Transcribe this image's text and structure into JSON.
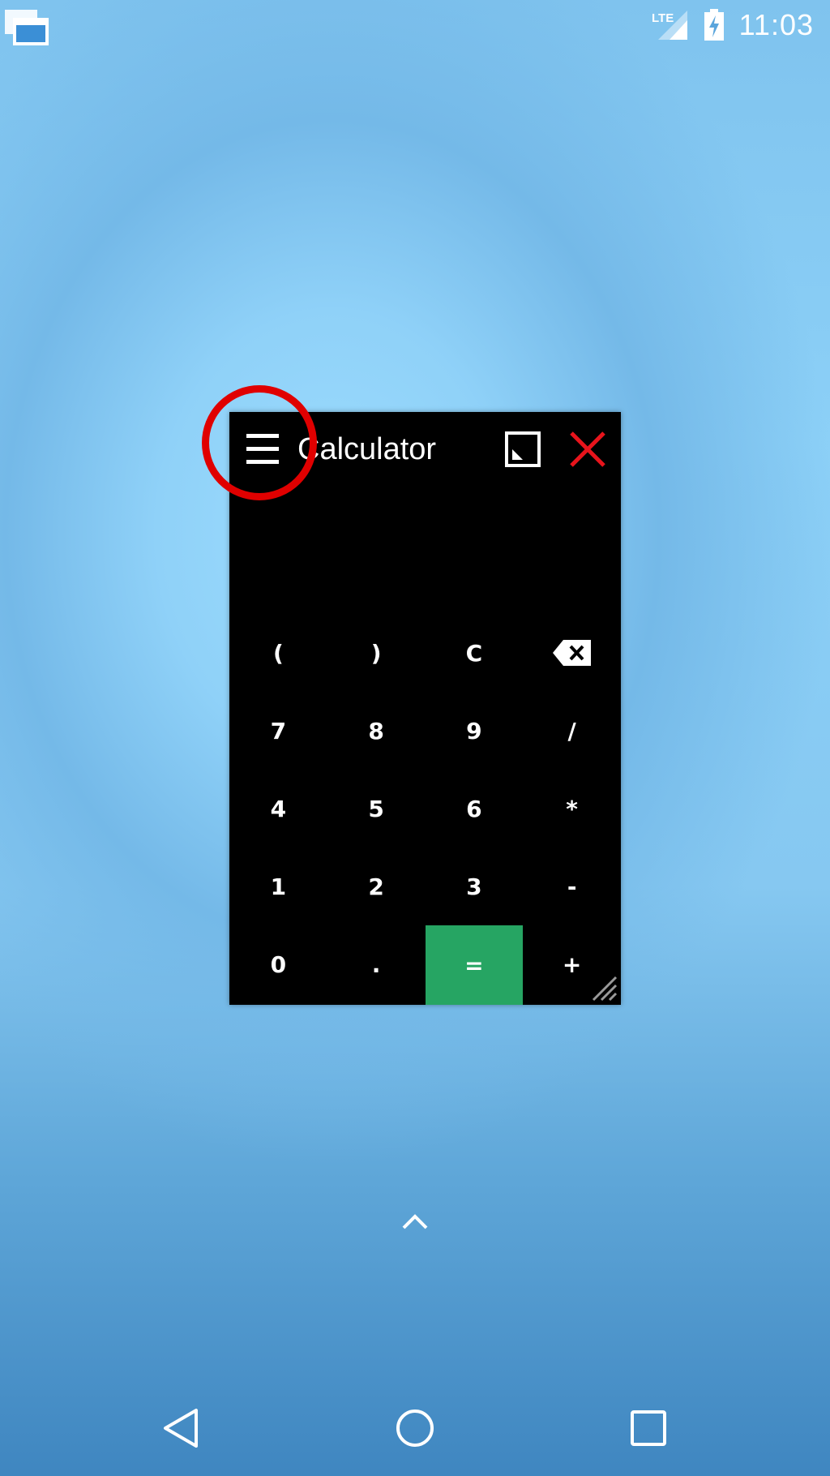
{
  "status_bar": {
    "network_label": "LTE",
    "time": "11:03",
    "icons": [
      "multi-window-notification-icon",
      "lte-signal-icon",
      "battery-charging-icon"
    ]
  },
  "window": {
    "title": "Calculator",
    "icons": [
      "menu-icon",
      "resize-window-icon",
      "close-icon",
      "resize-grip-icon"
    ],
    "close_color": "#e8141c",
    "display_value": "",
    "keys": [
      [
        "(",
        ")",
        "C",
        "backspace"
      ],
      [
        "7",
        "8",
        "9",
        "/"
      ],
      [
        "4",
        "5",
        "6",
        "*"
      ],
      [
        "1",
        "2",
        "3",
        "-"
      ],
      [
        "0",
        ".",
        "=",
        "+"
      ]
    ],
    "equals_color": "#26a563"
  },
  "annotation": {
    "type": "circle-highlight",
    "target": "menu-button",
    "color": "#e00000"
  },
  "home": {
    "icons": [
      "chevron-up-icon"
    ]
  },
  "nav_bar": {
    "icons": [
      "back-icon",
      "home-icon",
      "recents-icon"
    ]
  }
}
